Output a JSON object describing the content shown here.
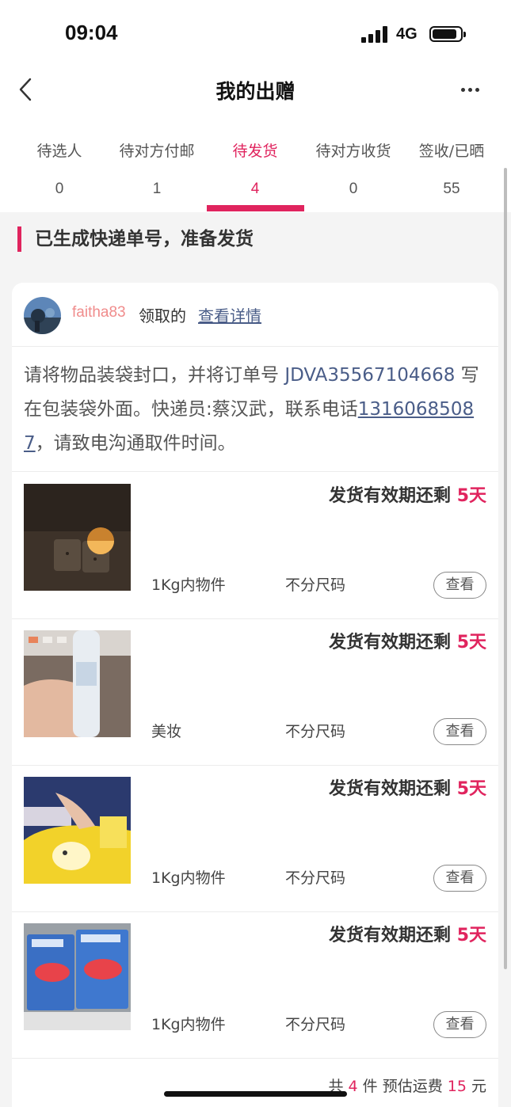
{
  "status": {
    "time": "09:04",
    "network": "4G"
  },
  "header": {
    "title": "我的出赠"
  },
  "tabs": [
    {
      "label": "待选人",
      "count": "0"
    },
    {
      "label": "待对方付邮",
      "count": "1"
    },
    {
      "label": "待发货",
      "count": "4"
    },
    {
      "label": "待对方收货",
      "count": "0"
    },
    {
      "label": "签收/已晒",
      "count": "55"
    }
  ],
  "active_tab": "待发货",
  "section": {
    "title": "已生成快递单号，准备发货"
  },
  "order": {
    "username": "faitha83",
    "claimed_label": "领取的",
    "details_link": "查看详情",
    "notice_prefix": "请将物品装袋封口，并将订单号 ",
    "tracking_code": "JDVA35567104668",
    "notice_middle": " 写在包装袋外面。快递员:蔡汉武，联系电话",
    "courier_phone": "13160685087",
    "notice_suffix": "，请致电沟通取件时间。"
  },
  "items": [
    {
      "deadline_label": "发货有效期还剩 ",
      "deadline_days": "5天",
      "category": "1Kg内物件",
      "size": "不分尺码",
      "view_label": "查看",
      "thumb": "night-light"
    },
    {
      "deadline_label": "发货有效期还剩 ",
      "deadline_days": "5天",
      "category": "美妆",
      "size": "不分尺码",
      "view_label": "查看",
      "thumb": "toner-bottle"
    },
    {
      "deadline_label": "发货有效期还剩 ",
      "deadline_days": "5天",
      "category": "1Kg内物件",
      "size": "不分尺码",
      "view_label": "查看",
      "thumb": "snack-pack"
    },
    {
      "deadline_label": "发货有效期还剩 ",
      "deadline_days": "5天",
      "category": "1Kg内物件",
      "size": "不分尺码",
      "view_label": "查看",
      "thumb": "mouth-tape"
    }
  ],
  "summary": {
    "prefix": "共 ",
    "count": "4",
    "middle": " 件 预估运费 ",
    "fee": "15",
    "suffix": " 元"
  },
  "colors": {
    "accent": "#e0245e",
    "link": "#4a5d88",
    "username": "#f08c8c"
  }
}
